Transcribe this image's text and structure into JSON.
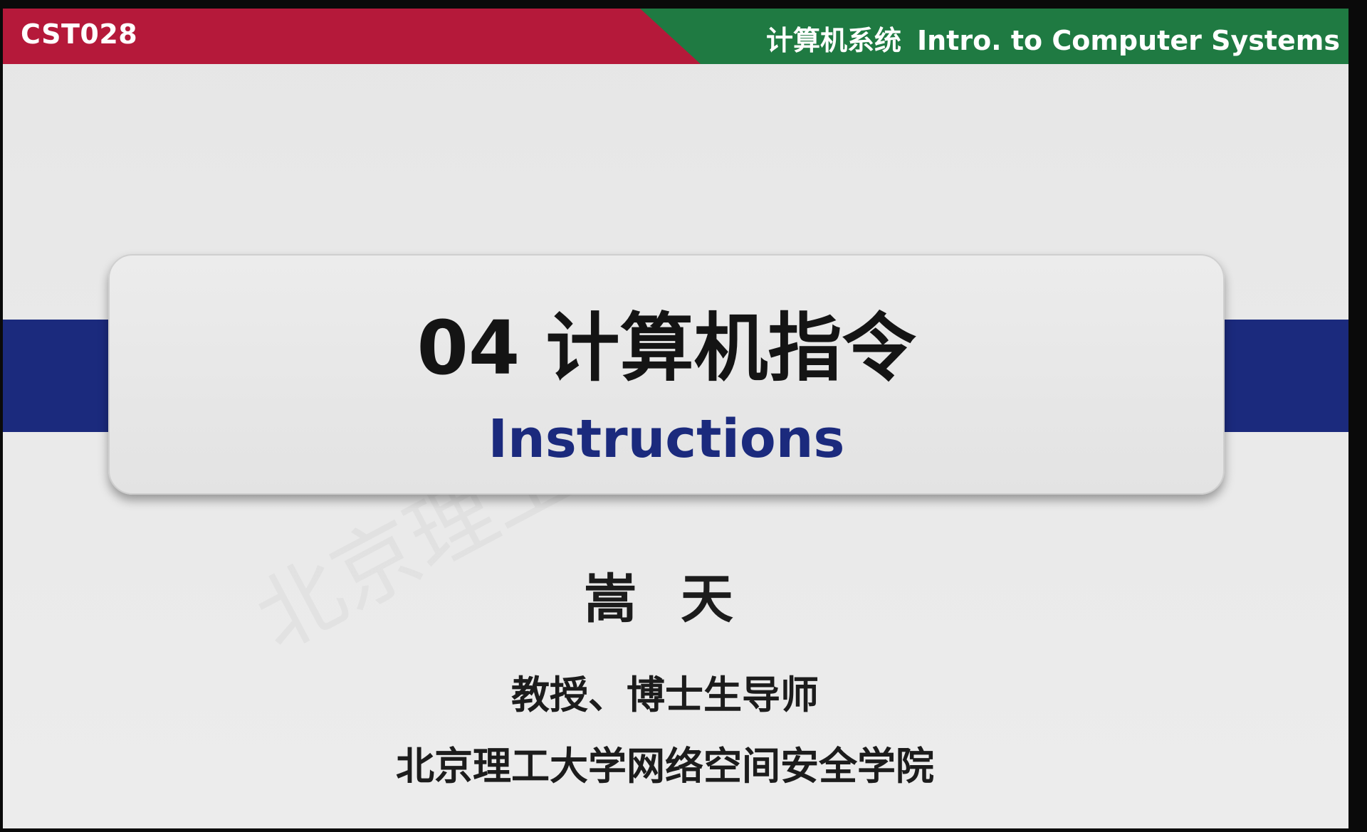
{
  "header": {
    "course_code": "CST028",
    "course_title_cn": "计算机系统",
    "course_title_en": "Intro. to Computer Systems"
  },
  "title_card": {
    "title": "04 计算机指令",
    "subtitle": "Instructions"
  },
  "presenter": {
    "name": "嵩 天",
    "role": "教授、博士生导师",
    "affiliation": "北京理工大学网络空间安全学院"
  },
  "watermark_text": "北京理工大学",
  "colors": {
    "header_red": "#b5193a",
    "header_green": "#1f7a42",
    "band_blue": "#1b2a7d",
    "subtitle_blue": "#1b2a7d",
    "slide_bg": "#e8e8e8"
  }
}
